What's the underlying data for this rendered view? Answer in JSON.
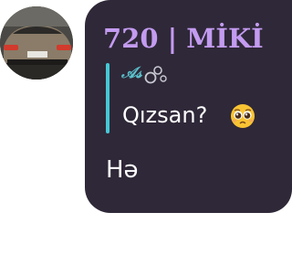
{
  "message": {
    "sender_name": "720 | MİKİ",
    "reply": {
      "author": "𝒜𝓈",
      "author_icon": "soap-bubbles-icon",
      "quoted_text": "Qızsan?",
      "quoted_emoji_icon": "pleading-face-icon"
    },
    "text": "Hə"
  },
  "colors": {
    "bubble_background": "#2f2838",
    "sender_name": "#c39bf0",
    "reply_accent": "#46c9d6",
    "text": "#ffffff"
  }
}
